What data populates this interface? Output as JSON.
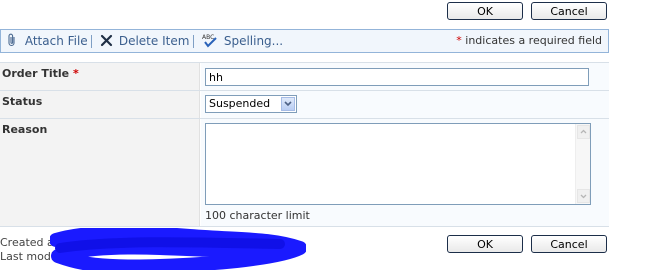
{
  "top_buttons": {
    "ok_label": "OK",
    "cancel_label": "Cancel"
  },
  "toolbar": {
    "attach_label": "Attach File",
    "delete_label": "Delete Item",
    "spelling_label": "Spelling...",
    "required_star": "*",
    "required_note": " indicates a required field",
    "icons": [
      "paperclip-icon",
      "delete-x-icon",
      "spellcheck-icon"
    ]
  },
  "form": {
    "order_title": {
      "label": "Order Title",
      "required_star": "*",
      "value": "hh"
    },
    "status": {
      "label": "Status",
      "selected": "Suspended"
    },
    "reason": {
      "label": "Reason",
      "value": "",
      "hint": "100 character limit"
    }
  },
  "footer": {
    "created_prefix": "Created at",
    "modified_prefix": "Last modifi",
    "redaction_color": "#1a1aff"
  },
  "bottom_buttons": {
    "ok_label": "OK",
    "cancel_label": "Cancel"
  },
  "colors": {
    "toolbar_link": "#3b5f8e",
    "required": "#ce0000",
    "label_bg": "#f3f3f3",
    "toolbar_border": "#93b4d9"
  }
}
